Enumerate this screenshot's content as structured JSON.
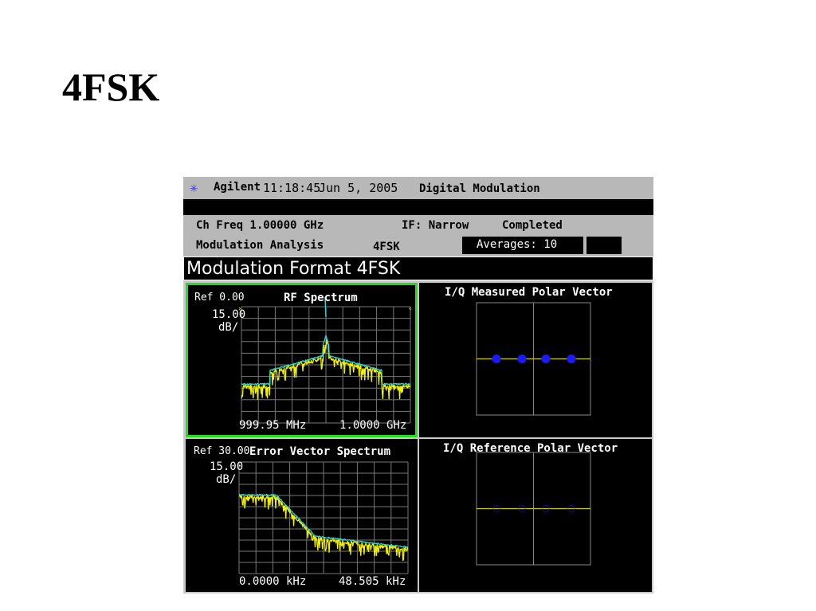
{
  "slide": {
    "title": "4FSK"
  },
  "header": {
    "brand": "Agilent",
    "time": "11:18:45",
    "date": "Jun 5, 2005",
    "mode": "Digital Modulation"
  },
  "info": {
    "ch_freq": "Ch Freq 1.00000 GHz",
    "if": "IF: Narrow",
    "status": "Completed",
    "measurement": "Modulation Analysis",
    "format": "4FSK",
    "averages": "Averages: 10"
  },
  "screen_title": "Modulation Format 4FSK",
  "panels": {
    "rf": {
      "ref": "Ref 0.00",
      "title": "RF Spectrum",
      "scale": "15.00",
      "unit": "dB/",
      "start": "999.95 MHz",
      "stop": "1.0000 GHz"
    },
    "evs": {
      "ref": "Ref 30.00",
      "title": "Error Vector Spectrum",
      "scale": "15.00",
      "unit": "dB/",
      "start": "0.0000 kHz",
      "stop": "48.505 kHz"
    },
    "measured": {
      "title": "I/Q Measured Polar Vector"
    },
    "reference": {
      "title": "I/Q Reference Polar Vector"
    }
  },
  "colors": {
    "trace_yellow": "#f0f000",
    "trace_cyan": "#30d8d0",
    "active_border": "#22dd22",
    "dot_blue": "#1a1aff"
  }
}
